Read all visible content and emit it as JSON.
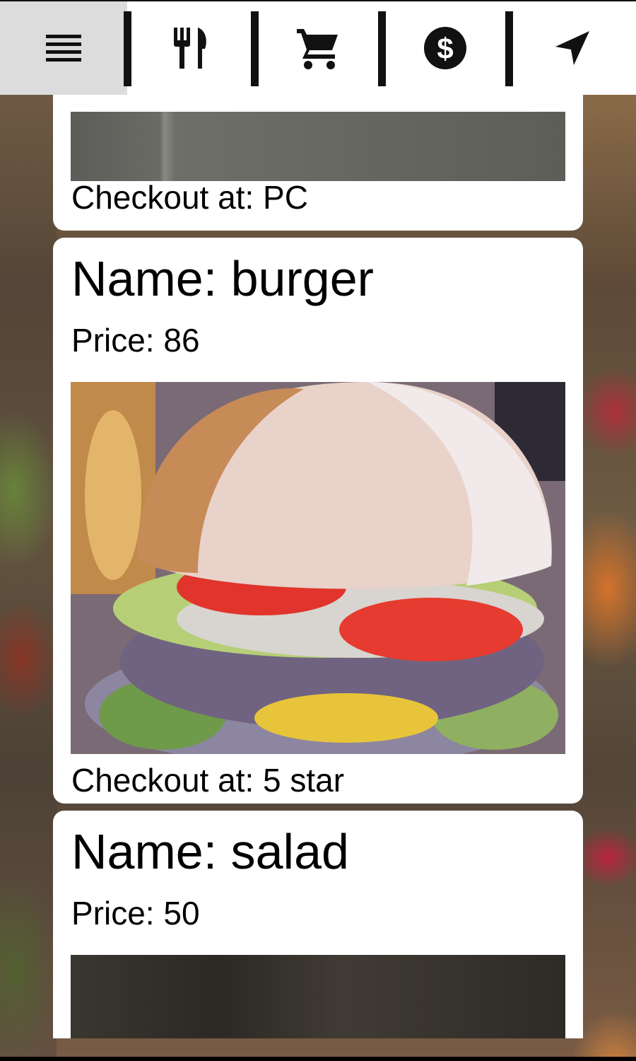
{
  "nav": {
    "tabs": [
      {
        "icon": "menu-icon",
        "active": true
      },
      {
        "icon": "restaurant-icon",
        "active": false
      },
      {
        "icon": "cart-icon",
        "active": false
      },
      {
        "icon": "dollar-icon",
        "active": false
      },
      {
        "icon": "navigation-arrow-icon",
        "active": false
      }
    ]
  },
  "items": [
    {
      "checkout_text": "Checkout at: PC"
    },
    {
      "name_text": "Name:  burger",
      "price_text": "Price:  86",
      "checkout_text": "Checkout at: 5 star"
    },
    {
      "name_text": "Name:  salad",
      "price_text": "Price:  50"
    }
  ],
  "colors": {
    "topbar_bg": "#ffffff",
    "active_tab_bg": "#dcdcdc",
    "card_bg": "#ffffff",
    "icon": "#111111"
  }
}
